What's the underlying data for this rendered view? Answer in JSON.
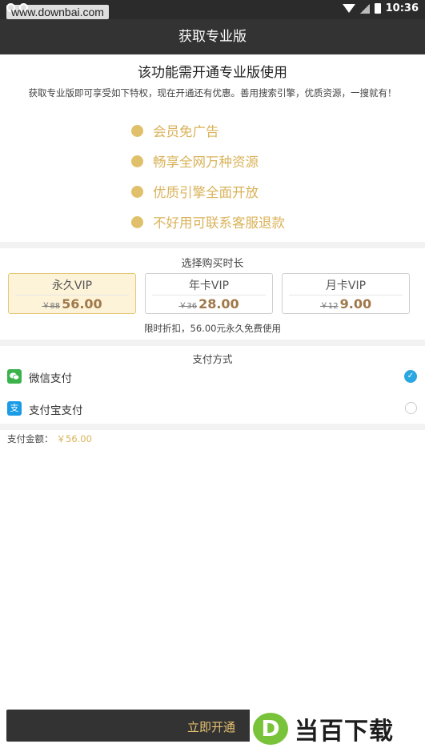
{
  "status_bar": {
    "time": "10:36"
  },
  "watermark": "www.downbai.com",
  "header": {
    "title": "获取专业版"
  },
  "intro": {
    "heading": "该功能需开通专业版使用",
    "subtitle": "获取专业版即可享受如下特权，现在开通还有优惠。善用搜索引擎，优质资源，一搜就有！"
  },
  "features": [
    "会员免广告",
    "畅享全网万种资源",
    "优质引擎全面开放",
    "不好用可联系客服退款"
  ],
  "duration": {
    "title": "选择购买时长",
    "plans": [
      {
        "name": "永久VIP",
        "old_price": "￥88",
        "price": "56.00",
        "selected": true
      },
      {
        "name": "年卡VIP",
        "old_price": "￥36",
        "price": "28.00",
        "selected": false
      },
      {
        "name": "月卡VIP",
        "old_price": "￥12",
        "price": "9.00",
        "selected": false
      }
    ],
    "promo_note": "限时折扣，56.00元永久免费使用"
  },
  "payment": {
    "title": "支付方式",
    "methods": [
      {
        "label": "微信支付",
        "selected": true
      },
      {
        "label": "支付宝支付",
        "selected": false
      }
    ],
    "amount_label": "支付金额：",
    "amount_value": "￥56.00"
  },
  "cta": {
    "label": "立即开通"
  },
  "brand": {
    "mark": "D",
    "text": "当百下载"
  },
  "colors": {
    "accent_gold": "#d9b35a",
    "dark_bar": "#333333",
    "wechat_green": "#3bb34a",
    "alipay_blue": "#1a9be6",
    "radio_blue": "#2aa7e0"
  }
}
